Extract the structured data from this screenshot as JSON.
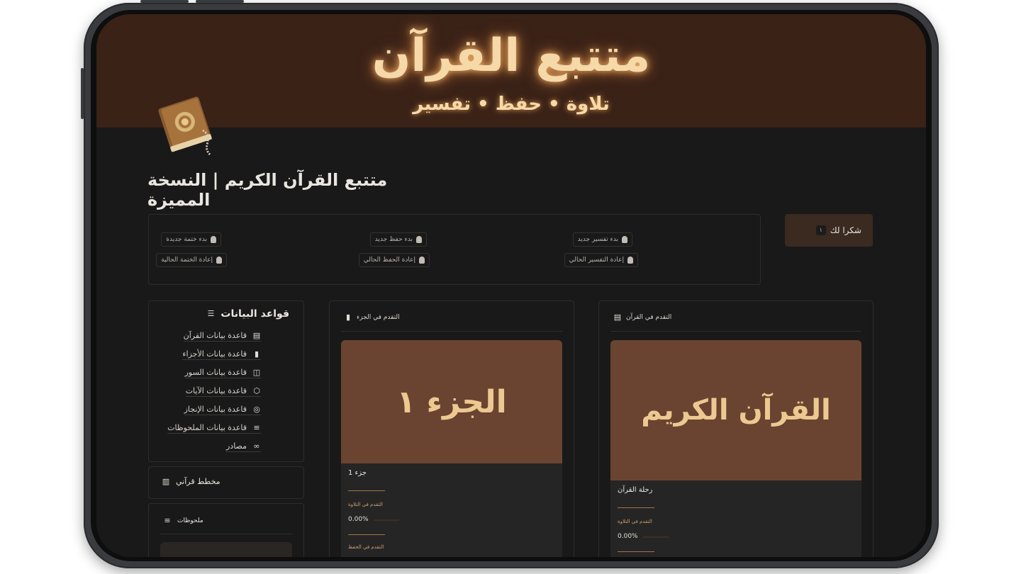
{
  "banner": {
    "title": "متتبع القرآن",
    "subtitle": "تلاوة • حفظ • تفسير"
  },
  "page_title": "متتبع القرآن الكريم | النسخة المميزة",
  "thanks": {
    "label": "شكرا لك",
    "badge": "١"
  },
  "actions": [
    {
      "label": "بدء تفسير جديد"
    },
    {
      "label": "بدء حفظ جديد"
    },
    {
      "label": "بدء ختمة جديدة"
    },
    {
      "label": "إعادة التفسير الحالي"
    },
    {
      "label": "إعادة الحفظ الحالي"
    },
    {
      "label": "إعادة الختمة الحالية"
    }
  ],
  "databases": {
    "title": "قواعد البيانات",
    "items": [
      {
        "label": "قاعدة بيانات القرآن",
        "icon": "book-icon"
      },
      {
        "label": "قاعدة بيانات الأجزاء",
        "icon": "bookmark-icon"
      },
      {
        "label": "قاعدة بيانات السور",
        "icon": "open-book-icon"
      },
      {
        "label": "قاعدة بيانات الآيات",
        "icon": "hexagon-icon"
      },
      {
        "label": "قاعدة بيانات الإنجاز",
        "icon": "target-icon"
      },
      {
        "label": "قاعدة بيانات الملحوظات",
        "icon": "notes-icon"
      },
      {
        "label": "مصادر",
        "icon": "link-icon"
      }
    ]
  },
  "planner": {
    "label": "مخطط قرآني"
  },
  "notes": {
    "label": "ملحوظات"
  },
  "juz_card": {
    "header": "التقدم في الجزء",
    "cover_text": "الجزء ١",
    "title": "جزء 1",
    "progress_label": "التقدم في التلاوة",
    "progress_value": "0.00%",
    "second_label": "التقدم في الحفظ"
  },
  "quran_card": {
    "header": "التقدم في القرآن",
    "cover_text": "القرآن الكريم",
    "title": "رحلة القرآن",
    "progress_label": "التقدم في التلاوة",
    "progress_value": "0.00%"
  }
}
